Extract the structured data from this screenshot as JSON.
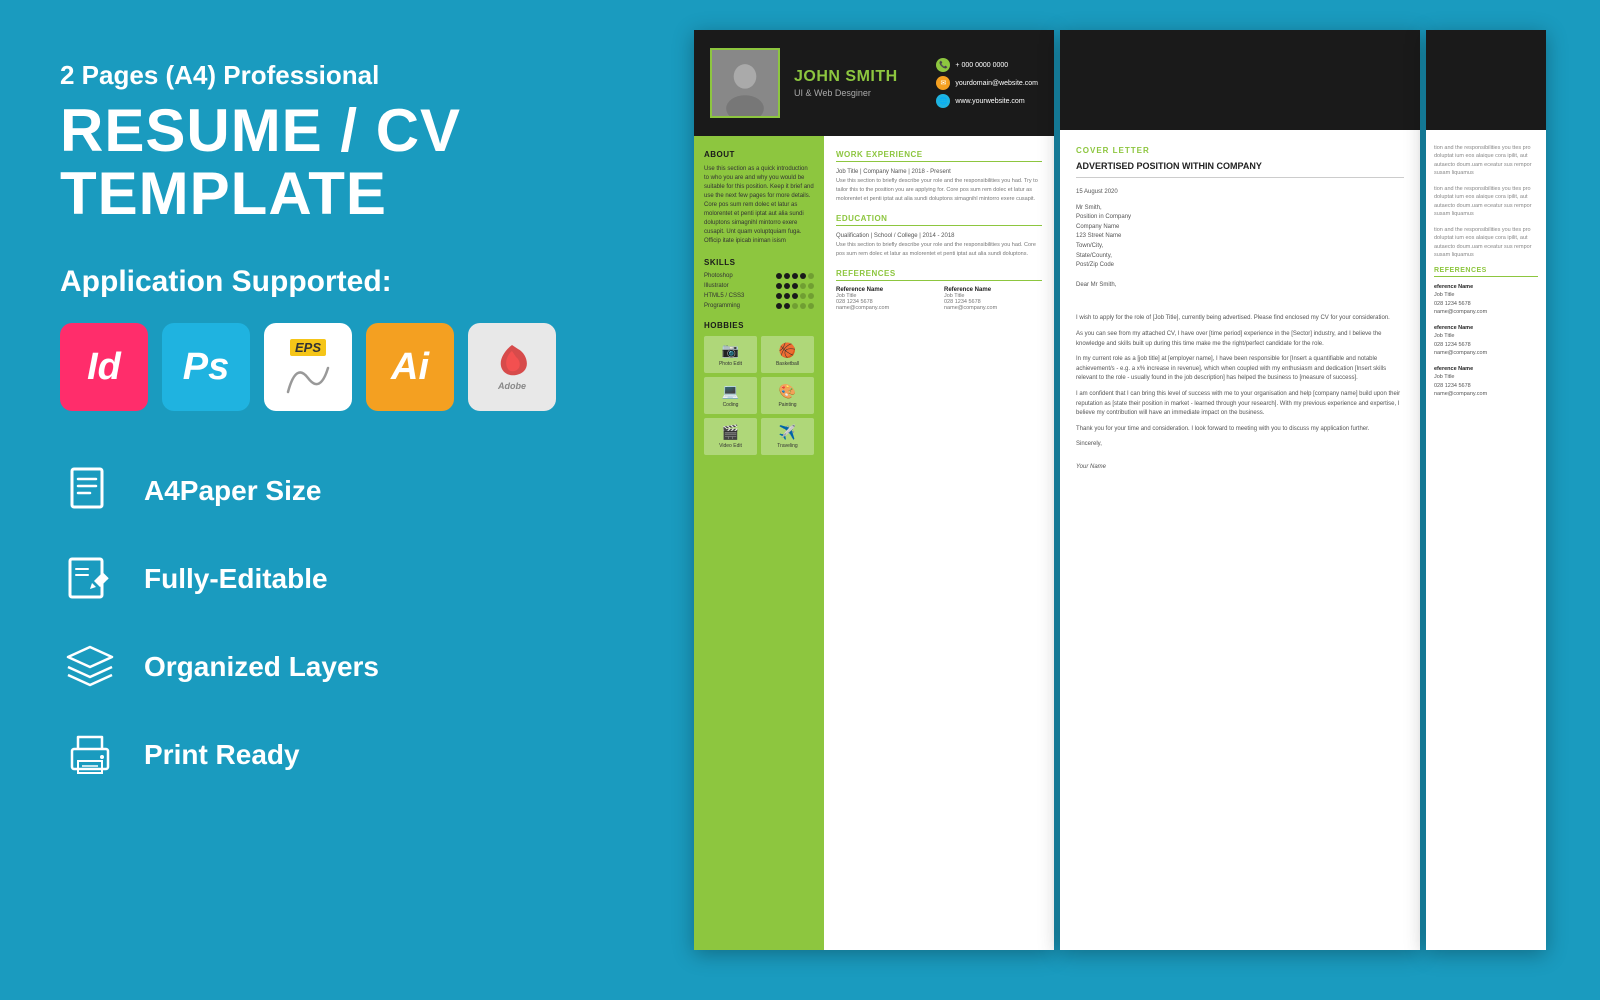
{
  "left": {
    "subtitle": "2 Pages (A4) Professional",
    "main_title": "RESUME / CV TEMPLATE",
    "app_supported_label": "Application Supported:",
    "apps": [
      {
        "name": "InDesign",
        "abbr": "Id",
        "type": "indesign"
      },
      {
        "name": "Photoshop",
        "abbr": "Ps",
        "type": "photoshop"
      },
      {
        "name": "EPS",
        "abbr": "EPS",
        "type": "eps"
      },
      {
        "name": "Illustrator",
        "abbr": "Ai",
        "type": "illustrator"
      },
      {
        "name": "Adobe PDF",
        "abbr": "PDF",
        "type": "pdf"
      }
    ],
    "features": [
      {
        "label": "A4Paper Size",
        "icon": "document"
      },
      {
        "label": "Fully-Editable",
        "icon": "edit"
      },
      {
        "label": "Organized Layers",
        "icon": "layers"
      },
      {
        "label": "Print Ready",
        "icon": "print"
      }
    ]
  },
  "cv": {
    "name": "JOHN SMITH",
    "title": "UI & Web Desginer",
    "contact": {
      "phone": "+ 000 0000 0000",
      "email": "yourdomain@website.com",
      "web": "www.yourwebsite.com"
    },
    "about_text": "Use this section as a quick introduction to who you are and why you would be suitable for this position. Keep it brief and use the next few pages for more details. Core pos sum rem dolec et latur as molorentet et penti iptat aut alia sundi doluptons simagnihl mintorro exere cusapit. Unt quam voluptquiam fuga. Officip itate ipicab iniman isism",
    "skills": [
      {
        "name": "Photoshop",
        "level": 4,
        "max": 5
      },
      {
        "name": "Illustrator",
        "level": 3,
        "max": 5
      },
      {
        "name": "HTML5 / CSS3",
        "level": 3,
        "max": 5
      },
      {
        "name": "Programming",
        "level": 2,
        "max": 5
      }
    ],
    "hobbies": [
      {
        "label": "Photo Edit",
        "icon": "📷"
      },
      {
        "label": "Basketball",
        "icon": "🏀"
      },
      {
        "label": "Coding",
        "icon": "💻"
      },
      {
        "label": "Painting",
        "icon": "🎨"
      },
      {
        "label": "Video Edit",
        "icon": "🎬"
      },
      {
        "label": "Traveling",
        "icon": "✈️"
      }
    ],
    "cover_letter": {
      "section_label": "COVER LETTER",
      "position": "ADVERTISED POSITION WITHIN COMPANY",
      "date": "15 August 2020",
      "addressee": "Mr Smith,\nPosition in Company\nCompany Name\n123 Street Name\nTown/City,\nState/County,\nPost/Zip Code",
      "salutation": "Dear Mr Smith,",
      "body": [
        "I wish to apply for the role of [Job Title], currently being advertised. Please find enclosed my CV for your consideration.",
        "As you can see from my attached CV, I have over [time period] experience in the [Sector] industry, and I believe the knowledge and skills built up during this time make me the right/perfect candidate for the role.",
        "In my current role as a [job title] at [employer name], I have been responsible for [Insert a quantifiable and notable achievement/s - e.g. a x% increase in revenue], which when coupled with my enthusiasm and dedication [Insert skills relevant to the role - usually found in the job description] has helped the business to [measure of success].",
        "I am confident that I can bring this level of success with me to your organisation and help [company name] build upon their reputation as [state their position in market - learned through your research]. With my previous experience and expertise, I believe my contribution will have an immediate impact on the business.",
        "Thank you for your time and consideration. I look forward to meeting with you to discuss my application further.",
        "Sincerely,"
      ],
      "signature": "Your Name"
    },
    "references": [
      {
        "name": "eference Name",
        "job_title": "Job Title",
        "phone": "028 1234 5678",
        "email": "name@company.com"
      },
      {
        "name": "eference Name",
        "job_title": "Job Title",
        "phone": "028 1234 5678",
        "email": "name@company.com"
      },
      {
        "name": "eference Name",
        "job_title": "Job Title",
        "phone": "028 1234 5678",
        "email": "name@company.com"
      }
    ],
    "ref_desc_text": "tion and the responsibilities you ttes pro doluptat ium eos alaique cora ipilit, aut autaecto doum.uam eceatur sus rempor susam liquamus"
  }
}
